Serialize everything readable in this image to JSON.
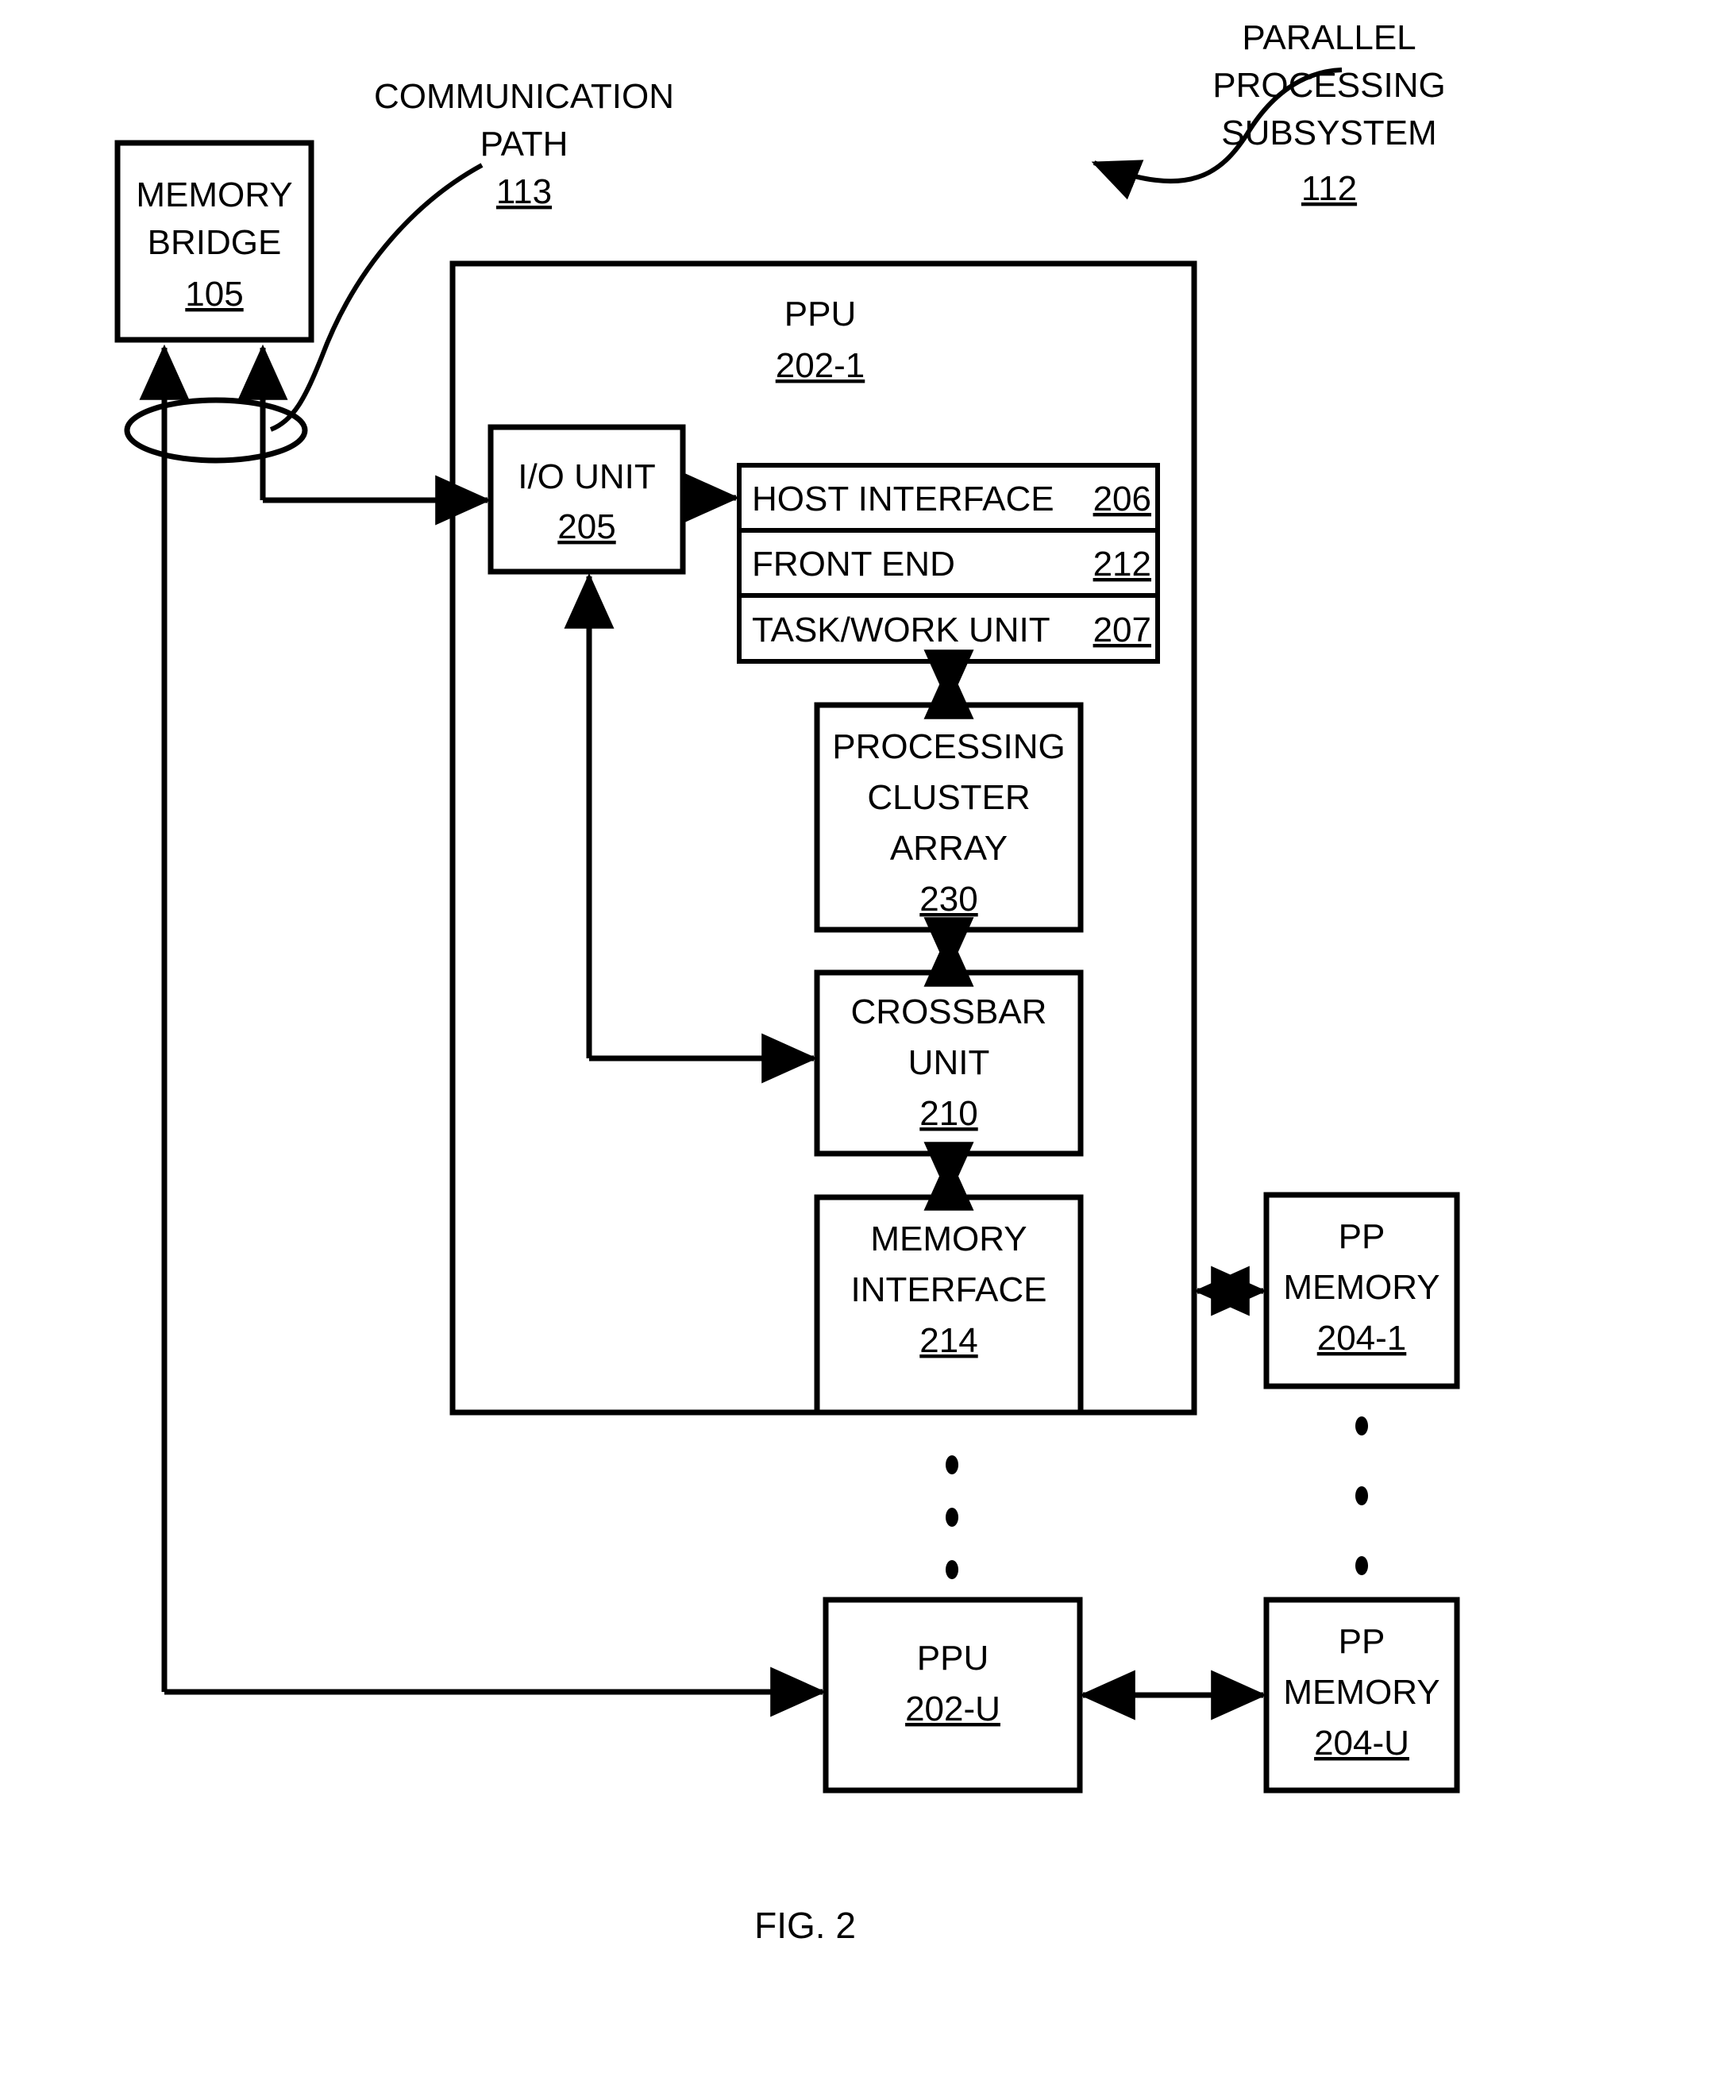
{
  "figure": {
    "caption": "FIG. 2"
  },
  "annotations": {
    "communication_path": {
      "line1": "COMMUNICATION",
      "line2": "PATH",
      "ref": "113"
    },
    "parallel_processing_subsystem": {
      "line1": "PARALLEL",
      "line2": "PROCESSING",
      "line3": "SUBSYSTEM",
      "ref": "112"
    }
  },
  "blocks": {
    "memory_bridge": {
      "line1": "MEMORY",
      "line2": "BRIDGE",
      "ref": "105"
    },
    "ppu_1": {
      "label": "PPU",
      "ref": "202-1"
    },
    "io_unit": {
      "label": "I/O UNIT",
      "ref": "205"
    },
    "host_interface": {
      "label": "HOST INTERFACE",
      "ref": "206"
    },
    "front_end": {
      "label": "FRONT END",
      "ref": "212"
    },
    "task_work_unit": {
      "label": "TASK/WORK UNIT",
      "ref": "207"
    },
    "processing_cluster_array": {
      "line1": "PROCESSING",
      "line2": "CLUSTER",
      "line3": "ARRAY",
      "ref": "230"
    },
    "crossbar_unit": {
      "line1": "CROSSBAR",
      "line2": "UNIT",
      "ref": "210"
    },
    "memory_interface": {
      "line1": "MEMORY",
      "line2": "INTERFACE",
      "ref": "214"
    },
    "pp_memory_1": {
      "line1": "PP",
      "line2": "MEMORY",
      "ref": "204-1"
    },
    "ppu_u": {
      "label": "PPU",
      "ref": "202-U"
    },
    "pp_memory_u": {
      "line1": "PP",
      "line2": "MEMORY",
      "ref": "204-U"
    }
  },
  "colors": {
    "ink": "#000000",
    "paper": "#ffffff"
  }
}
